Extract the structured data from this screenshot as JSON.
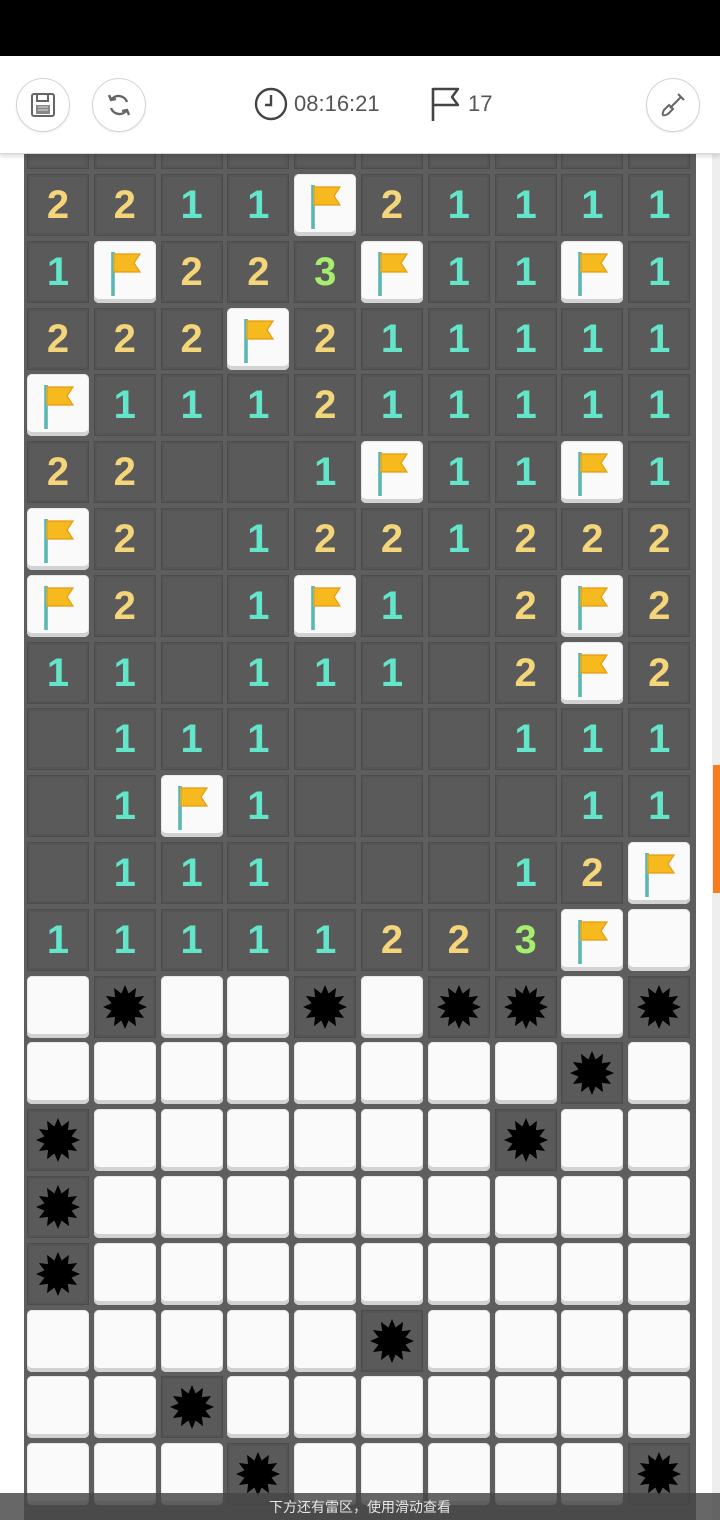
{
  "toolbar": {
    "timer": "08:16:21",
    "flag_count": "17",
    "save_icon": "save-icon",
    "restart_icon": "refresh-icon",
    "dig_icon": "shovel-icon"
  },
  "board": {
    "columns": 10,
    "legend": {
      "F": "flagged",
      "C": "unrevealed",
      "M": "mine",
      ".": "revealed-empty",
      "1-3": "adjacent mine count"
    },
    "rows": [
      "2211F21111",
      "1F223F11F1",
      "222F211111",
      "F111211111",
      "22..1F11F1",
      "F2.1221222",
      "F2.1F1.2F2",
      "11.111.2F2",
      ".111...111",
      ".1F1....11",
      ".111...12F",
      "1111122 3FC",
      "CMCCMCMMCM",
      "CCCCCCCCMC",
      "MCCCCCCMCC",
      "MCCCCCCCCC",
      "MCCCCCCCCC",
      "CCCCCMCCCC",
      "CCMCCCCCCC",
      "CCCMCCCCCM"
    ],
    "colors": {
      "one": "#63e5c9",
      "two": "#f4d57a",
      "three": "#a6ee6e",
      "accent": "#f57c1f"
    }
  },
  "hint": "下方还有雷区，使用滑动查看"
}
